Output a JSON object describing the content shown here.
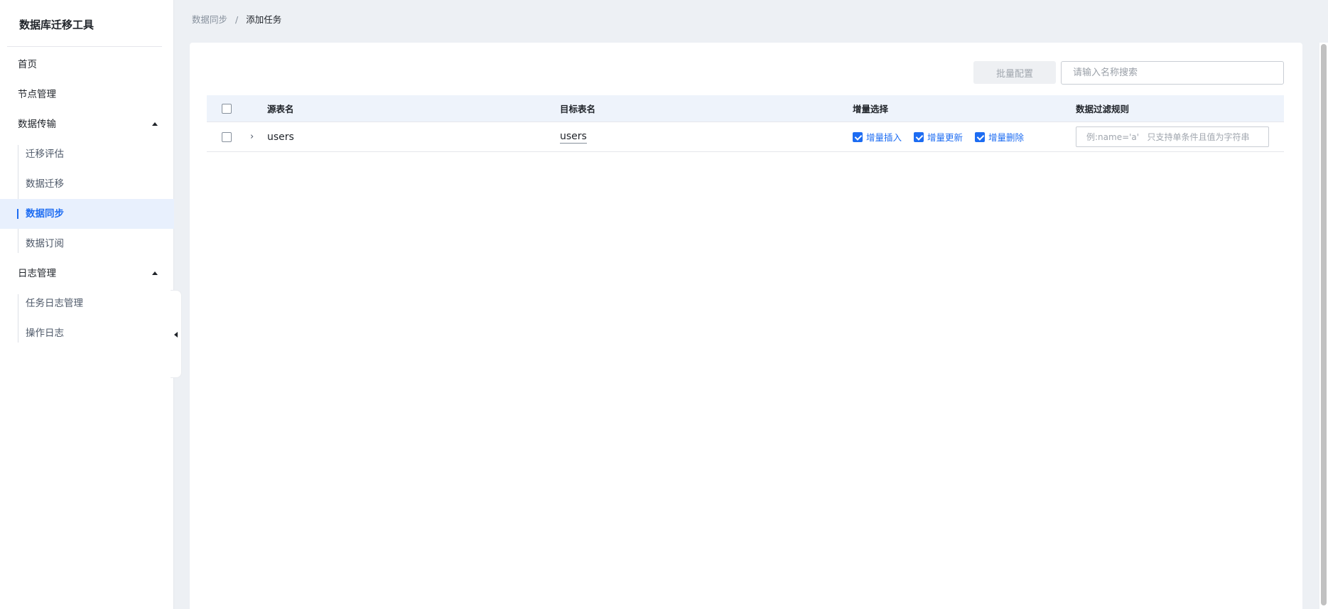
{
  "app": {
    "title": "数据库迁移工具"
  },
  "sidebar": {
    "items": [
      {
        "label": "首页"
      },
      {
        "label": "节点管理"
      }
    ],
    "groups": [
      {
        "label": "数据传输",
        "expanded": true,
        "children": [
          {
            "label": "迁移评估"
          },
          {
            "label": "数据迁移"
          },
          {
            "label": "数据同步",
            "active": true
          },
          {
            "label": "数据订阅"
          }
        ]
      },
      {
        "label": "日志管理",
        "expanded": true,
        "children": [
          {
            "label": "任务日志管理"
          },
          {
            "label": "操作日志"
          }
        ]
      }
    ]
  },
  "breadcrumb": {
    "parent": "数据同步",
    "separator": "/",
    "current": "添加任务"
  },
  "toolbar": {
    "batch_label": "批量配置",
    "search_placeholder": "请输入名称搜索"
  },
  "table": {
    "columns": {
      "source": "源表名",
      "target": "目标表名",
      "incremental": "增量选择",
      "filter": "数据过滤规则"
    },
    "rows": [
      {
        "checked": false,
        "source": "users",
        "target": "users",
        "options": [
          {
            "label": "增量插入",
            "checked": true
          },
          {
            "label": "增量更新",
            "checked": true
          },
          {
            "label": "增量删除",
            "checked": true
          }
        ],
        "filter_placeholder": "例:name='a'   只支持单条件且值为字符串"
      }
    ]
  },
  "colors": {
    "accent": "#1d6cf2",
    "active_bg": "#e8f0fd",
    "page_bg": "#edf0f4",
    "header_bg": "#eef3fb"
  }
}
